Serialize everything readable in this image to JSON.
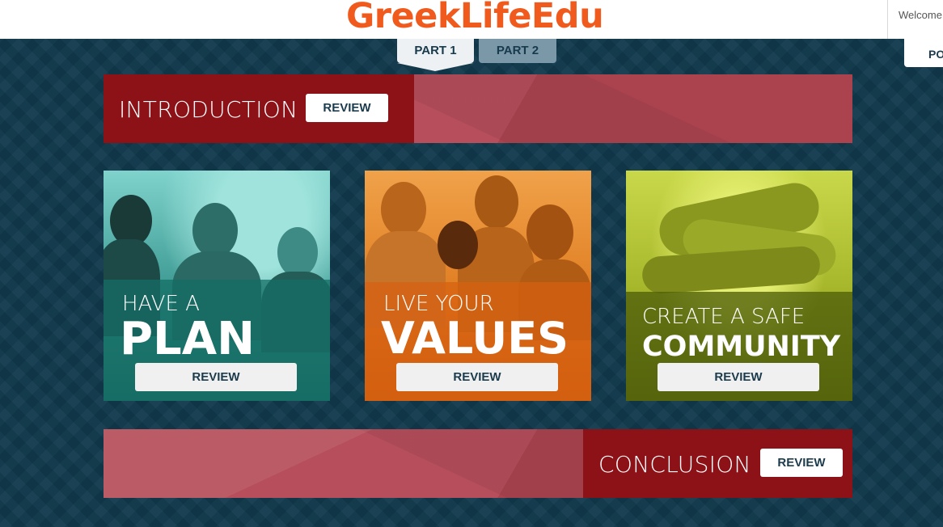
{
  "header": {
    "logo": "GreekLifeEdu",
    "welcome_text": "Welcome",
    "side_tab_label": "PO"
  },
  "tabs": [
    {
      "label": "PART 1",
      "active": true
    },
    {
      "label": "PART 2",
      "active": false
    }
  ],
  "introduction": {
    "title": "INTRODUCTION",
    "button": "REVIEW"
  },
  "cards": [
    {
      "subtitle": "HAVE A",
      "title": "PLAN",
      "button": "REVIEW",
      "color": "#1f8a80"
    },
    {
      "subtitle": "LIVE YOUR",
      "title": "VALUES",
      "button": "REVIEW",
      "color": "#d9681a"
    },
    {
      "subtitle": "CREATE A SAFE",
      "title": "COMMUNITY",
      "button": "REVIEW",
      "color": "#5d6b12"
    }
  ],
  "conclusion": {
    "title": "CONCLUSION",
    "button": "REVIEW"
  },
  "colors": {
    "brand": "#f05a1d",
    "background": "#10394c",
    "banner_red": "#8c1218",
    "banner_light": "#b24652"
  }
}
